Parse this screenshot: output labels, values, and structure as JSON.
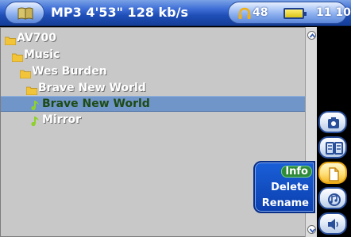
{
  "header": {
    "title": "MP3 4'53\" 128 kb/s",
    "volume": "48",
    "clock": "11 10"
  },
  "tree": [
    {
      "label": "AV700",
      "type": "folder",
      "depth": 0,
      "selected": false
    },
    {
      "label": "Music",
      "type": "folder",
      "depth": 1,
      "selected": false
    },
    {
      "label": "Wes Burden",
      "type": "folder",
      "depth": 2,
      "selected": false
    },
    {
      "label": "Brave New World",
      "type": "folder",
      "depth": 3,
      "selected": false
    },
    {
      "label": "Brave New World",
      "type": "music",
      "depth": 4,
      "selected": true
    },
    {
      "label": "Mirror",
      "type": "music",
      "depth": 4,
      "selected": false
    }
  ],
  "context_menu": {
    "items": [
      {
        "label": "Info",
        "selected": true
      },
      {
        "label": "Delete",
        "selected": false
      },
      {
        "label": "Rename",
        "selected": false
      }
    ]
  },
  "side_buttons": [
    {
      "icon": "copy-to-device-icon",
      "active": false
    },
    {
      "icon": "dual-pane-icon",
      "active": false
    },
    {
      "icon": "file-options-icon",
      "active": true
    },
    {
      "icon": "playlist-icon",
      "active": false
    },
    {
      "icon": "speaker-icon",
      "active": false
    }
  ],
  "colors": {
    "header_blue": "#1f4fb8",
    "browser_bg": "#c8c8c8",
    "selection": "#6f95c9",
    "folder_yellow": "#f2c43a",
    "music_green": "#8ed12b",
    "menu_blue": "#1a5fd8",
    "menu_selected": "#2f8a3a"
  }
}
